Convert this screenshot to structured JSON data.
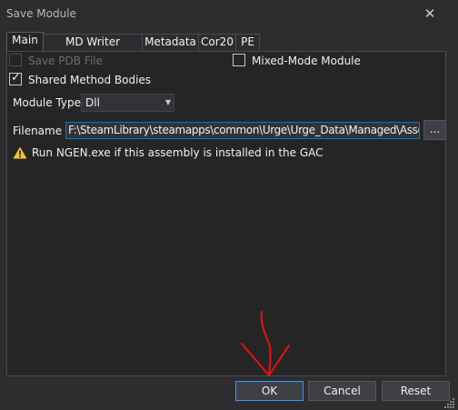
{
  "window": {
    "title": "Save Module"
  },
  "tabs": [
    {
      "label": "Main",
      "active": true
    },
    {
      "label": "MD Writer Options",
      "active": false
    },
    {
      "label": "Metadata",
      "active": false
    },
    {
      "label": "Cor20",
      "active": false
    },
    {
      "label": "PE",
      "active": false
    }
  ],
  "main": {
    "save_pdb": {
      "label": "Save PDB File",
      "checked": false,
      "enabled": false
    },
    "mixed_mode": {
      "label": "Mixed-Mode Module",
      "checked": false,
      "enabled": true
    },
    "shared_method_bodies": {
      "label": "Shared Method Bodies",
      "checked": true,
      "enabled": true
    },
    "module_type": {
      "label": "Module Type",
      "value": "Dll"
    },
    "filename": {
      "label": "Filename",
      "value": "F:\\SteamLibrary\\steamapps\\common\\Urge\\Urge_Data\\Managed\\Assembly-CSharp.dll",
      "browse_label": "..."
    },
    "warning": "Run NGEN.exe if this assembly is installed in the GAC"
  },
  "buttons": {
    "ok": "OK",
    "cancel": "Cancel",
    "reset": "Reset"
  },
  "colors": {
    "accent": "#007acc",
    "annotation_arrow": "#e81010",
    "warning": "#f2c230"
  },
  "icons": {
    "close": "close-icon",
    "warning": "warning-icon",
    "checkbox": "check-icon",
    "dropdown": "chevron-down-icon",
    "resize": "resize-grip-icon"
  }
}
